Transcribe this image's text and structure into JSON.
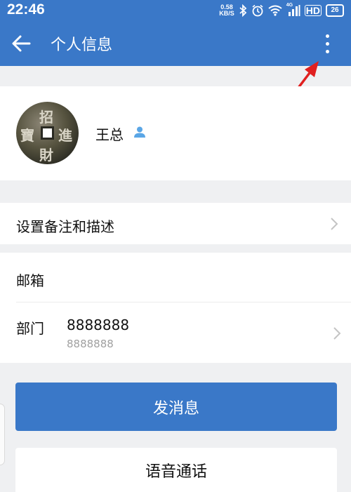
{
  "status_bar": {
    "time": "22:46",
    "net_speed_value": "0.58",
    "net_speed_unit": "KB/S",
    "network": "4G",
    "hd": "HD",
    "battery": "26"
  },
  "app_bar": {
    "title": "个人信息"
  },
  "profile": {
    "name": "王总",
    "avatar_chars": [
      "招",
      "進",
      "財",
      "寶"
    ]
  },
  "remark": {
    "label": "设置备注和描述"
  },
  "info": {
    "email_label": "邮箱",
    "dept_label": "部门",
    "dept_value": "8888888",
    "dept_sub": "8888888"
  },
  "actions": {
    "send_message": "发消息",
    "voice_call": "语音通话"
  },
  "colors": {
    "primary": "#3a78c8",
    "annotation_arrow": "#e02020"
  }
}
